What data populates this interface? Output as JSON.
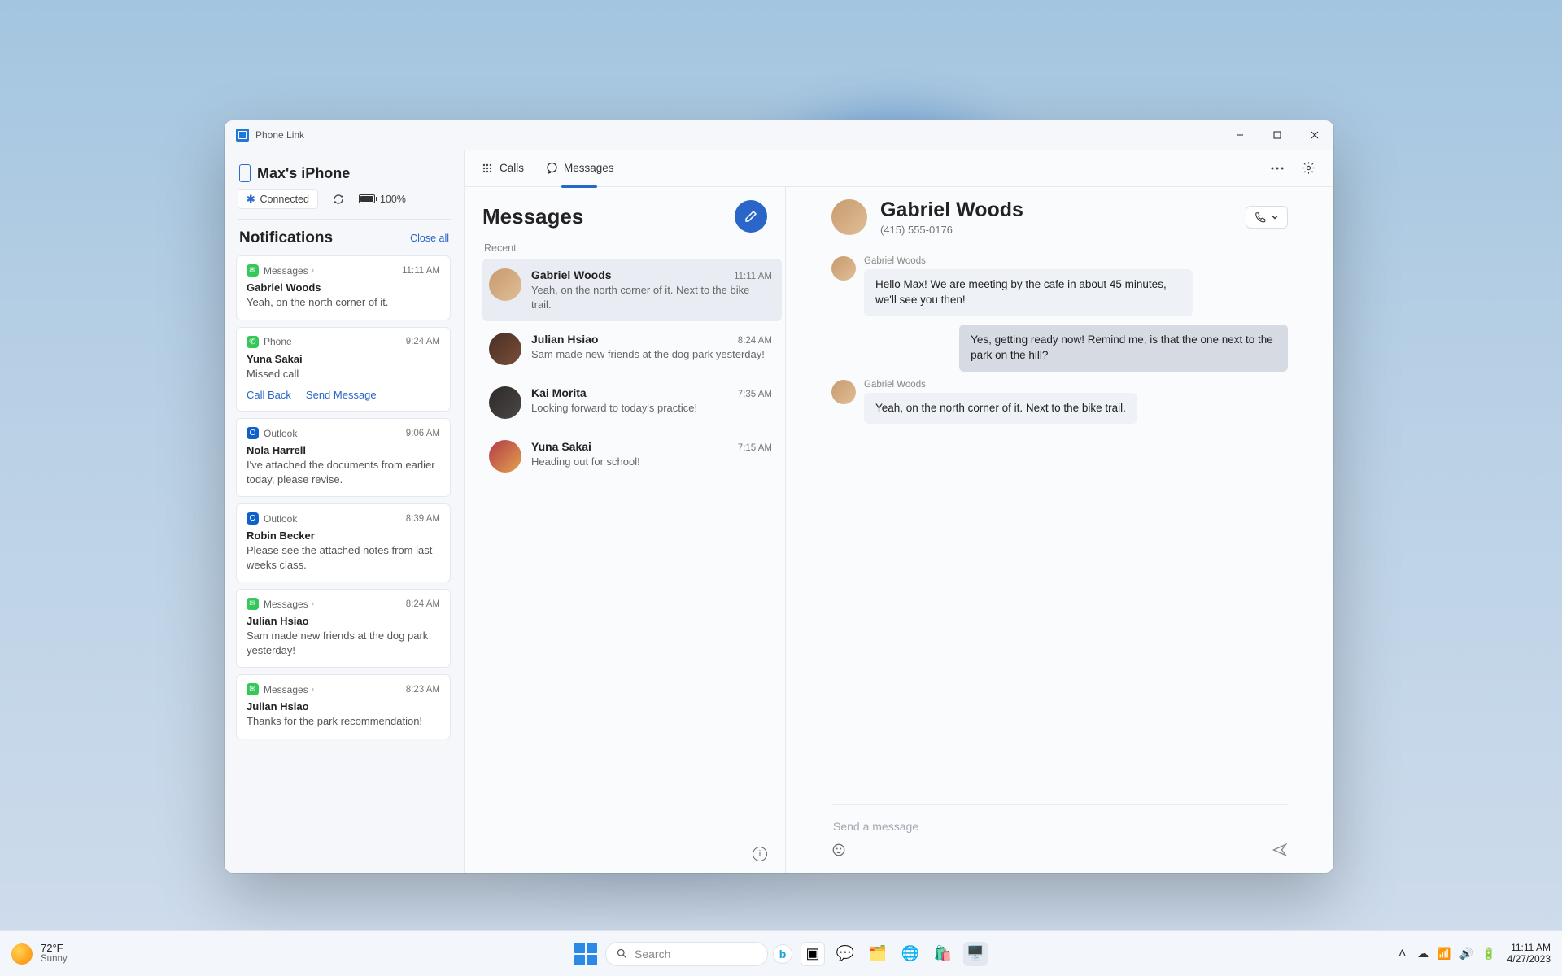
{
  "app": {
    "title": "Phone Link"
  },
  "device": {
    "name": "Max's iPhone",
    "connection_label": "Connected",
    "battery_label": "100%"
  },
  "tabs": {
    "calls": "Calls",
    "messages": "Messages"
  },
  "notifications": {
    "title": "Notifications",
    "close_all": "Close all",
    "items": [
      {
        "app": "Messages",
        "time": "11:11 AM",
        "title": "Gabriel Woods",
        "body": "Yeah, on the north corner of it.",
        "icon": "messages",
        "chevron": true
      },
      {
        "app": "Phone",
        "time": "9:24 AM",
        "title": "Yuna Sakai",
        "body": "Missed call",
        "icon": "phone",
        "actions": [
          "Call Back",
          "Send Message"
        ]
      },
      {
        "app": "Outlook",
        "time": "9:06 AM",
        "title": "Nola Harrell",
        "body": "I've attached the documents from earlier today, please revise.",
        "icon": "outlook"
      },
      {
        "app": "Outlook",
        "time": "8:39 AM",
        "title": "Robin Becker",
        "body": "Please see the attached notes from last weeks class.",
        "icon": "outlook"
      },
      {
        "app": "Messages",
        "time": "8:24 AM",
        "title": "Julian Hsiao",
        "body": "Sam made new friends at the dog park yesterday!",
        "icon": "messages",
        "chevron": true
      },
      {
        "app": "Messages",
        "time": "8:23 AM",
        "title": "Julian Hsiao",
        "body": "Thanks for the park recommendation!",
        "icon": "messages",
        "chevron": true
      }
    ]
  },
  "messages": {
    "title": "Messages",
    "section": "Recent",
    "threads": [
      {
        "name": "Gabriel Woods",
        "time": "11:11 AM",
        "preview": "Yeah, on the north corner of it. Next to the bike trail.",
        "avatar": "av1",
        "selected": true
      },
      {
        "name": "Julian Hsiao",
        "time": "8:24 AM",
        "preview": "Sam made new friends at the dog park yesterday!",
        "avatar": "av2"
      },
      {
        "name": "Kai Morita",
        "time": "7:35 AM",
        "preview": "Looking forward to today's practice!",
        "avatar": "av3"
      },
      {
        "name": "Yuna Sakai",
        "time": "7:15 AM",
        "preview": "Heading out for school!",
        "avatar": "av4"
      }
    ]
  },
  "chat": {
    "name": "Gabriel Woods",
    "phone": "(415) 555-0176",
    "messages": [
      {
        "from": "them",
        "sender": "Gabriel Woods",
        "text": "Hello Max! We are meeting by the cafe in about 45 minutes, we'll see you then!"
      },
      {
        "from": "me",
        "text": "Yes, getting ready now! Remind me, is that the one next to the park on the hill?"
      },
      {
        "from": "them",
        "sender": "Gabriel Woods",
        "text": "Yeah, on the north corner of it. Next to the bike trail."
      }
    ],
    "placeholder": "Send a message"
  },
  "taskbar": {
    "weather_temp": "72°F",
    "weather_desc": "Sunny",
    "search_placeholder": "Search",
    "time": "11:11 AM",
    "date": "4/27/2023"
  }
}
